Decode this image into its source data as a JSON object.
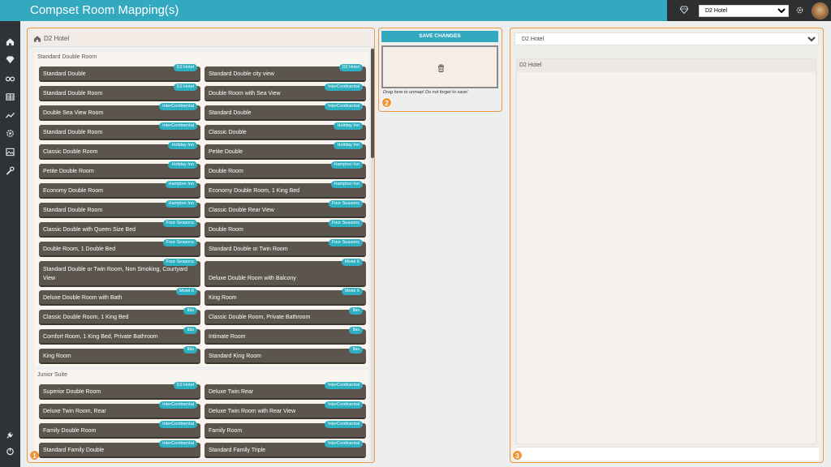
{
  "app": {
    "title": "Compset Room Mapping(s)"
  },
  "header": {
    "hotel_select": {
      "value": "D2 Hotel",
      "options": [
        "D2 Hotel"
      ]
    },
    "icons": [
      "diamond-icon",
      "gear-icon"
    ],
    "accent": "#33a9c0"
  },
  "sidebar": {
    "items": [
      "home-icon",
      "diamond-icon",
      "binoculars-icon",
      "grid-icon",
      "chart-icon",
      "settings-icon",
      "image-icon",
      "wrench-icon",
      "plug-icon",
      "power-icon"
    ]
  },
  "panel1": {
    "step": "1",
    "hotel": "D2 Hotel",
    "groups": [
      {
        "title": "Standard Double Room",
        "rows": [
          [
            {
              "name": "Standard Double",
              "tag": "D2 Hotel"
            },
            {
              "name": "Standard Double city view",
              "tag": "D2 Hotel"
            }
          ],
          [
            {
              "name": "Standard Double Room",
              "tag": "D2 Hotel"
            },
            {
              "name": "Double Room with Sea View",
              "tag": "InterContinental"
            }
          ],
          [
            {
              "name": "Double Sea View Room",
              "tag": "InterContinental"
            },
            {
              "name": "Standard Double",
              "tag": "InterContinental"
            }
          ],
          [
            {
              "name": "Standard Double Room",
              "tag": "InterContinental"
            },
            {
              "name": "Classic Double",
              "tag": "Holiday Inn"
            }
          ],
          [
            {
              "name": "Classic Double Room",
              "tag": "Holiday Inn"
            },
            {
              "name": "Petite Double",
              "tag": "Holiday Inn"
            }
          ],
          [
            {
              "name": "Petite Double Room",
              "tag": "Holiday Inn"
            },
            {
              "name": "Double Room",
              "tag": "Hampton Inn"
            }
          ],
          [
            {
              "name": "Economy Double Room",
              "tag": "Hampton Inn"
            },
            {
              "name": "Economy Double Room, 1 King Bed",
              "tag": "Hampton Inn"
            }
          ],
          [
            {
              "name": "Standard Double Room",
              "tag": "Hampton Inn"
            },
            {
              "name": "Classic Double Rear View",
              "tag": "Four Seasons"
            }
          ],
          [
            {
              "name": "Classic Double with Queen Size Bed",
              "tag": "Four Seasons"
            },
            {
              "name": "Double Room",
              "tag": "Four Seasons"
            }
          ],
          [
            {
              "name": "Double Room, 1 Double Bed",
              "tag": "Four Seasons"
            },
            {
              "name": "Standard Double or Twin Room",
              "tag": "Four Seasons"
            }
          ],
          [
            {
              "name": "Standard Double or Twin Room, Non Smoking, Courtyard View",
              "tag": "Four Seasons"
            },
            {
              "name": "Deluxe Double Room with Balcony",
              "tag": "Motel 6"
            }
          ],
          [
            {
              "name": "Deluxe Double Room with Bath",
              "tag": "Motel 6"
            },
            {
              "name": "King Room",
              "tag": "Motel 6"
            }
          ],
          [
            {
              "name": "Classic Double Room, 1 King Bed",
              "tag": "Ibis"
            },
            {
              "name": "Classic Double Room, Private Bathroom",
              "tag": "Ibis"
            }
          ],
          [
            {
              "name": "Comfort Room, 1 King Bed, Private Bathroom",
              "tag": "Ibis"
            },
            {
              "name": "Intimate Room",
              "tag": "Ibis"
            }
          ],
          [
            {
              "name": "King Room",
              "tag": "Ibis"
            },
            {
              "name": "Standard King Room",
              "tag": "Ibis"
            }
          ]
        ]
      },
      {
        "title": "Junior Suite",
        "rows": [
          [
            {
              "name": "Superior Double Room",
              "tag": "D2 Hotel"
            },
            {
              "name": "Deluxe Twin Rear",
              "tag": "InterContinental"
            }
          ],
          [
            {
              "name": "Deluxe Twin Room, Rear",
              "tag": "InterContinental"
            },
            {
              "name": "Deluxe Twin Room with Rear View",
              "tag": "InterContinental"
            }
          ],
          [
            {
              "name": "Family Double Room",
              "tag": "InterContinental"
            },
            {
              "name": "Family Room",
              "tag": "InterContinental"
            }
          ],
          [
            {
              "name": "Standard Family Double",
              "tag": "InterContinental"
            },
            {
              "name": "Standard Family Triple",
              "tag": "InterContinental"
            }
          ]
        ]
      }
    ]
  },
  "panel2": {
    "step": "2",
    "save_label": "SAVE CHANGES",
    "drop_hint": "Drag here to unmap! Do not forget to save!"
  },
  "panel3": {
    "step": "3",
    "select_value": "D2 Hotel",
    "list_header": "D2 Hotel"
  },
  "colors": {
    "accent": "#33a9c0",
    "panel_border": "#f0953a",
    "room_card": "#5c554e",
    "tag": "#2fb0c1"
  }
}
